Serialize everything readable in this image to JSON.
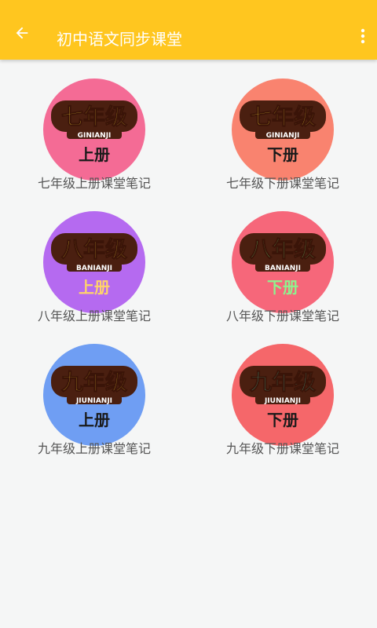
{
  "app": {
    "title": "初中语文同步课堂",
    "theme_color": "#ffc61f"
  },
  "icons": {
    "back": "arrow-left-icon",
    "menu": "more-vertical-icon"
  },
  "books": [
    {
      "grade": "七年级",
      "pinyin": "GINIANJI",
      "term": "上册",
      "caption": "七年级上册课堂笔记",
      "circle_color": "#f46b95",
      "term_color": "#1a1a1a",
      "grade_color": "#f7d23a",
      "pinyin_color": "#ffffff"
    },
    {
      "grade": "七年级",
      "pinyin": "GINIANJI",
      "term": "下册",
      "caption": "七年级下册课堂笔记",
      "circle_color": "#f9836f",
      "term_color": "#1a1a1a",
      "grade_color": "#f7d23a",
      "pinyin_color": "#ffffff"
    },
    {
      "grade": "八年级",
      "pinyin": "BANIANJI",
      "term": "上册",
      "caption": "八年级上册课堂笔记",
      "circle_color": "#b56af0",
      "term_color": "#ffd36a",
      "grade_color": "#f7d23a",
      "pinyin_color": "#ffffff"
    },
    {
      "grade": "八年级",
      "pinyin": "BANIANJI",
      "term": "下册",
      "caption": "八年级下册课堂笔记",
      "circle_color": "#f6677a",
      "term_color": "#8ef38e",
      "grade_color": "#6be07a",
      "pinyin_color": "#ffffff"
    },
    {
      "grade": "九年级",
      "pinyin": "JIUNIANJI",
      "term": "上册",
      "caption": "九年级上册课堂笔记",
      "circle_color": "#6f9ef3",
      "term_color": "#1a1a1a",
      "grade_color": "#f7d23a",
      "pinyin_color": "#ffffff"
    },
    {
      "grade": "九年级",
      "pinyin": "JIUNIANJI",
      "term": "下册",
      "caption": "九年级下册课堂笔记",
      "circle_color": "#f5676a",
      "term_color": "#1a1a1a",
      "grade_color": "#3fd6b6",
      "pinyin_color": "#ffffff"
    }
  ]
}
